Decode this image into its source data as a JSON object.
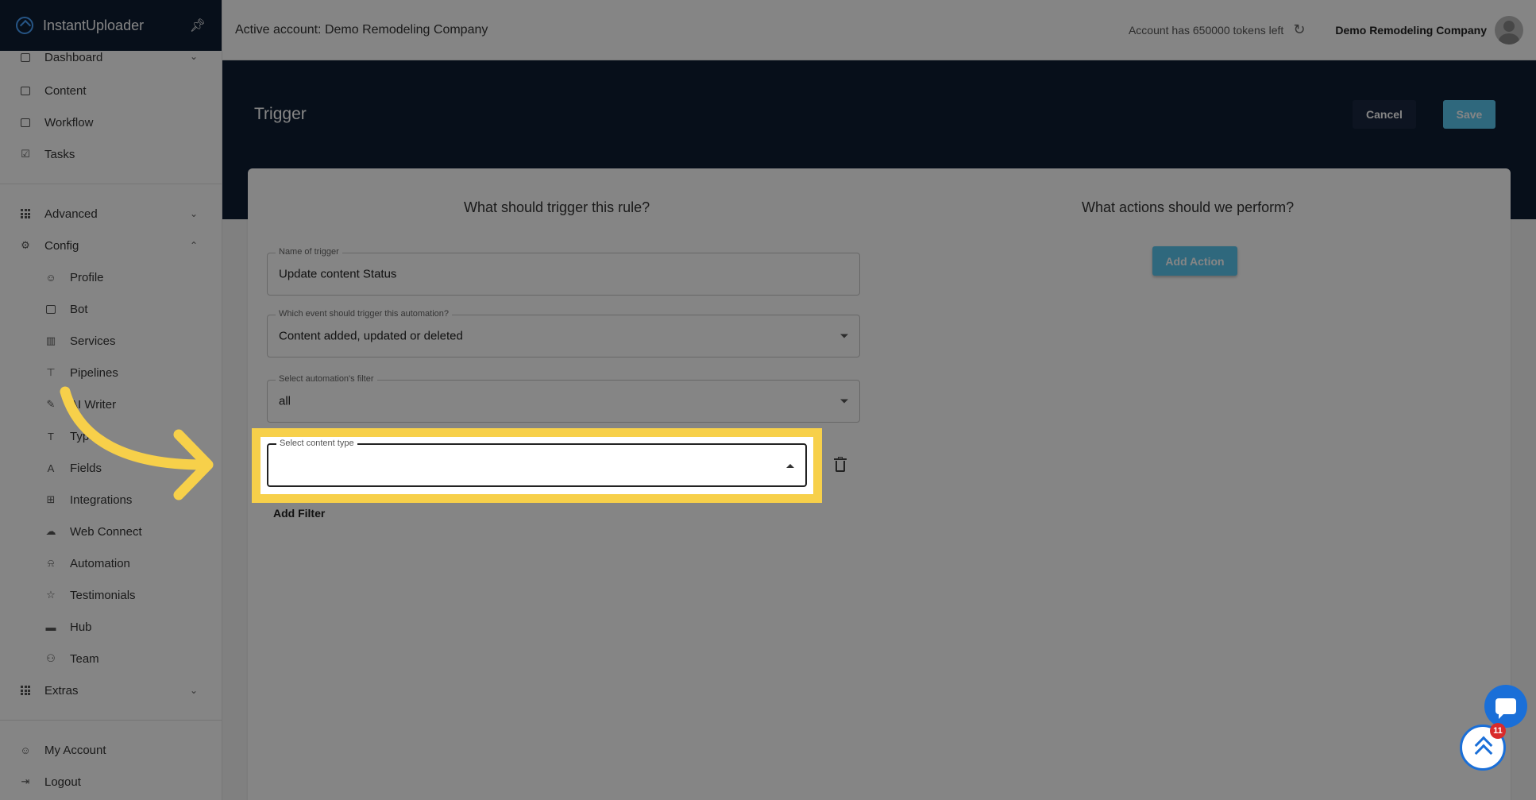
{
  "app": {
    "name": "InstantUploader"
  },
  "header": {
    "active_account": "Active account: Demo Remodeling Company",
    "tokens": "Account has 650000 tokens left",
    "company": "Demo Remodeling Company"
  },
  "sidebar": {
    "items": [
      {
        "label": "Dashboard",
        "icon": "dashboard-icon"
      },
      {
        "label": "Content",
        "icon": "folder-icon"
      },
      {
        "label": "Workflow",
        "icon": "workflow-icon"
      },
      {
        "label": "Tasks",
        "icon": "checkbox-icon"
      },
      {
        "label": "Advanced",
        "icon": "grid-icon"
      },
      {
        "label": "Config",
        "icon": "gear-icon"
      }
    ],
    "config_items": [
      {
        "label": "Profile",
        "icon": "person-icon"
      },
      {
        "label": "Bot",
        "icon": "chat-icon"
      },
      {
        "label": "Services",
        "icon": "services-icon"
      },
      {
        "label": "Pipelines",
        "icon": "pipelines-icon"
      },
      {
        "label": "AI Writer",
        "icon": "pencil-icon"
      },
      {
        "label": "Types",
        "icon": "text-type-icon"
      },
      {
        "label": "Fields",
        "icon": "fields-icon"
      },
      {
        "label": "Integrations",
        "icon": "integrations-icon"
      },
      {
        "label": "Web Connect",
        "icon": "cloud-icon"
      },
      {
        "label": "Automation",
        "icon": "bell-icon"
      },
      {
        "label": "Testimonials",
        "icon": "star-icon"
      },
      {
        "label": "Hub",
        "icon": "hub-icon"
      },
      {
        "label": "Team",
        "icon": "team-icon"
      }
    ],
    "extras": {
      "label": "Extras",
      "icon": "grid-icon"
    },
    "bottom_items": [
      {
        "label": "My Account",
        "icon": "person-icon"
      },
      {
        "label": "Logout",
        "icon": "logout-icon"
      }
    ]
  },
  "page": {
    "title": "Trigger",
    "cancel_label": "Cancel",
    "save_label": "Save",
    "left_heading": "What should trigger this rule?",
    "right_heading": "What actions should we perform?",
    "add_action_label": "Add Action",
    "fields": {
      "trigger_name": {
        "label": "Name of trigger",
        "value": "Update content Status"
      },
      "event": {
        "label": "Which event should trigger this automation?",
        "value": "Content added, updated or deleted"
      },
      "filter": {
        "label": "Select automation's filter",
        "value": "all"
      },
      "content_type": {
        "label": "Select content type",
        "value": ""
      }
    },
    "add_filter_label": "Add Filter"
  },
  "widgets": {
    "badge_count": "11"
  },
  "colors": {
    "highlight": "#f7d04a",
    "navy": "#0e1d33",
    "accent": "#5bc7f0"
  }
}
